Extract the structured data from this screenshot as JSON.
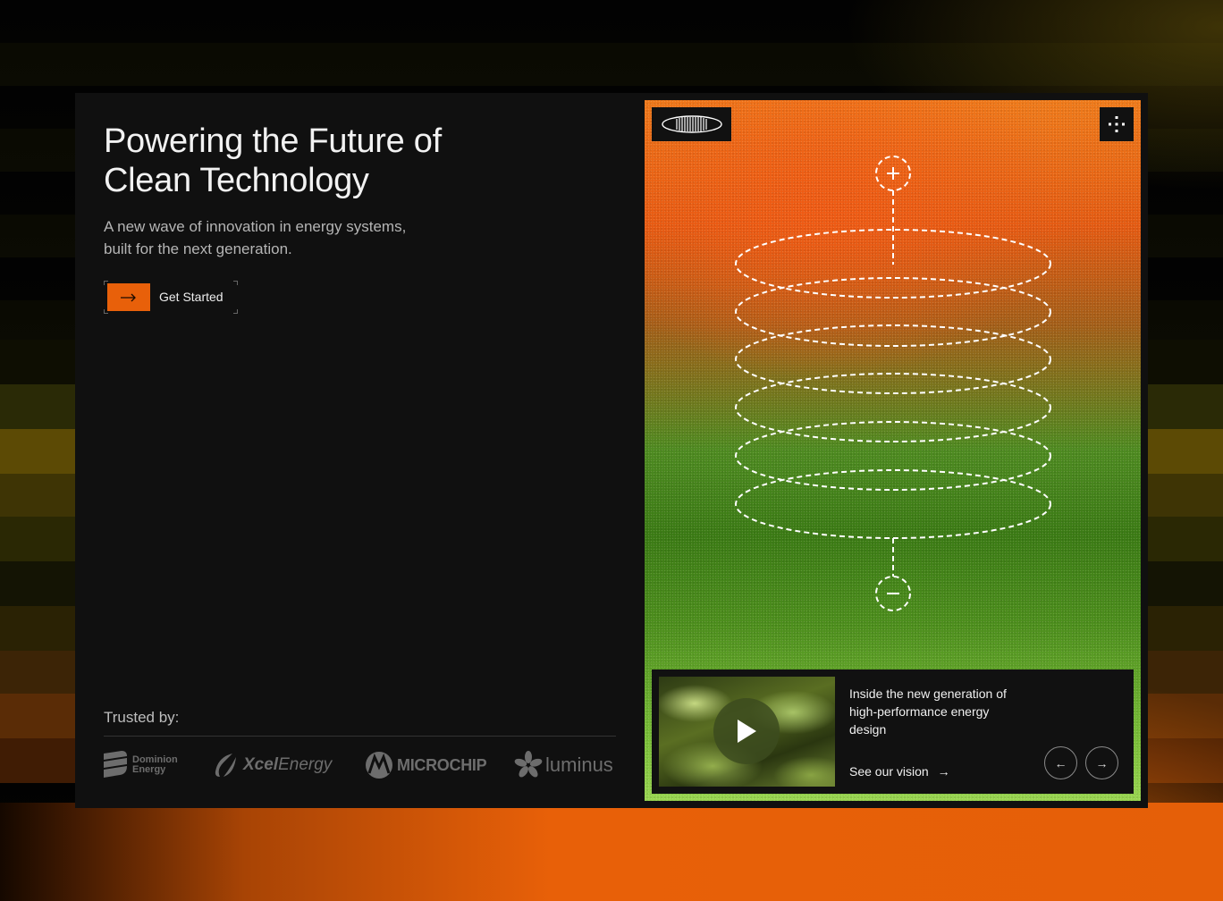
{
  "hero": {
    "title": "Powering the Future of Clean Technology",
    "subtitle": "A new wave of innovation in energy systems, built for the next generation.",
    "cta_label": "Get Started",
    "cta_icon": "arrow-right-icon"
  },
  "trusted": {
    "label": "Trusted by:",
    "logos": [
      {
        "name": "Dominion Energy",
        "line1": "Dominion",
        "line2": "Energy"
      },
      {
        "name": "Xcel Energy",
        "bold": "Xcel",
        "rest": "Energy"
      },
      {
        "name": "Microchip",
        "text": "MICROCHIP"
      },
      {
        "name": "luminus",
        "text": "luminus"
      }
    ]
  },
  "visual": {
    "plus_icon": "plus-icon",
    "minus_icon": "minus-icon",
    "menu_icon": "grid-dots-icon"
  },
  "feature": {
    "title": "Inside the new generation of high-performance energy design",
    "link_label": "See our vision",
    "link_arrow": "→",
    "prev_arrow": "←",
    "next_arrow": "→"
  },
  "colors": {
    "accent": "#e8600a",
    "card_bg": "#101010",
    "green": "#4d8a20"
  }
}
